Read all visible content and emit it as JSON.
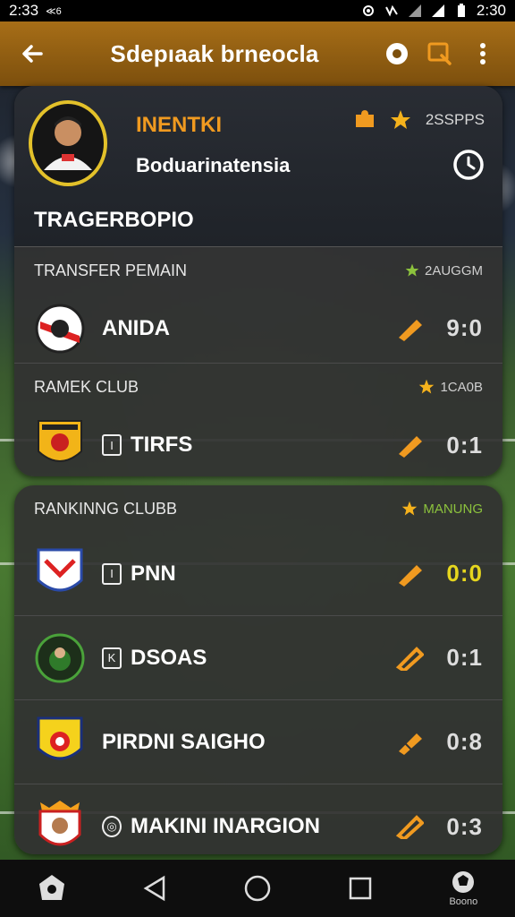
{
  "status_bar": {
    "time_left": "2:33",
    "time_left_suffix": "≪6",
    "time_right": "2:30",
    "icons": [
      "settings-icon",
      "vibrate-icon",
      "signal-icon",
      "signal-icon",
      "battery-icon"
    ]
  },
  "app_bar": {
    "title": "Sdepıaak brneocla",
    "back_icon": "arrow-left-icon",
    "actions": [
      "record-icon",
      "search-icon",
      "more-vert-icon"
    ]
  },
  "profile": {
    "name": "INENTKI",
    "subtitle": "Boduarinatensia",
    "stat_value": "2SSPPS",
    "section_title": "TRAGERBOPIO"
  },
  "colors": {
    "accent_orange": "#f09a20",
    "app_bar_brown": "#a76e17",
    "star_gold": "#f5b21c",
    "green_star": "#8cc23d",
    "score_yellow": "#e6d61e"
  },
  "transfer_section": {
    "header": "TRANSFER PEMAIN",
    "meta": "2AUGGM",
    "rows": [
      {
        "name": "ANIDA",
        "score": "9:0",
        "badge": ""
      }
    ]
  },
  "ramek_section": {
    "header": "RAMEK CLUB",
    "meta": "1CA0B",
    "rows": [
      {
        "name": "TIRFS",
        "score": "0:1",
        "badge": "I"
      }
    ]
  },
  "ranking_section": {
    "header": "RANKINNG CLUBB",
    "meta": "MANUNG",
    "rows": [
      {
        "name": "PNN",
        "score": "0:0",
        "badge": "I"
      },
      {
        "name": "DSOAS",
        "score": "0:1",
        "badge": "K"
      },
      {
        "name": "PIRDNI SAIGHO",
        "score": "0:8",
        "badge": ""
      },
      {
        "name": "MAKINI INARGION",
        "score": "0:3",
        "badge": "◎"
      }
    ]
  },
  "nav_bar": {
    "items": [
      "home-icon",
      "back-icon",
      "home-circle-icon",
      "recents-icon",
      "profile-icon"
    ],
    "profile_label": "Boono"
  }
}
